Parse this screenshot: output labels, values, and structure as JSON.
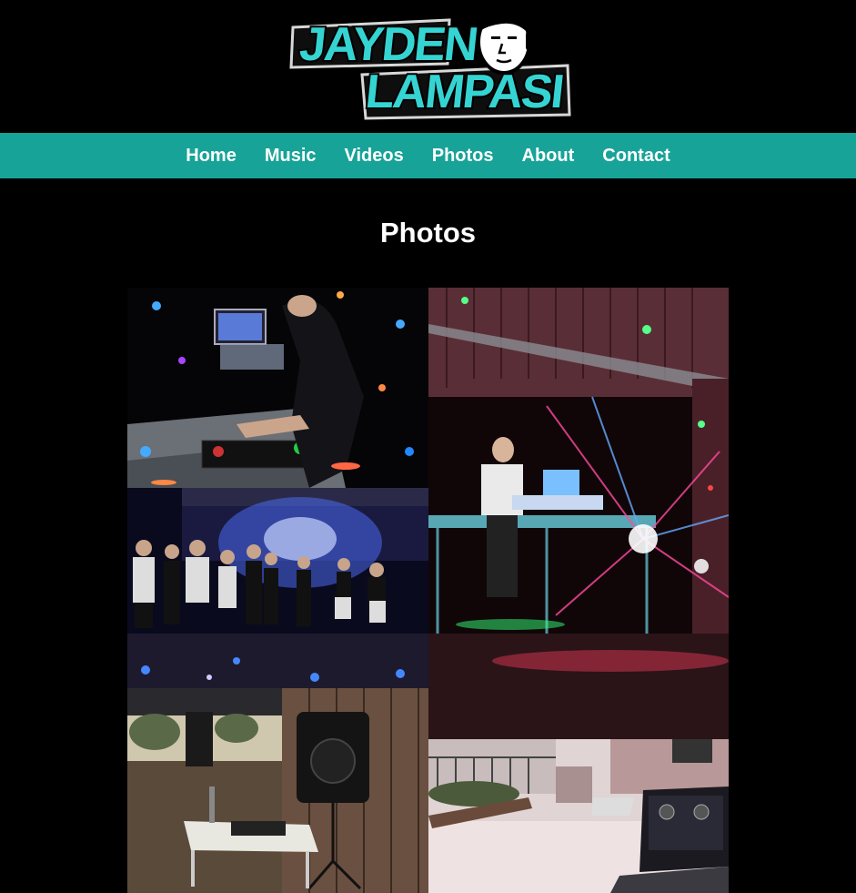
{
  "site": {
    "logo_line1": "JAYDEN",
    "logo_line2": "LAMPASI",
    "brand_color": "#2fd0cf",
    "nav_color": "#17a398"
  },
  "nav": {
    "items": [
      {
        "label": "Home"
      },
      {
        "label": "Music"
      },
      {
        "label": "Videos"
      },
      {
        "label": "Photos"
      },
      {
        "label": "About"
      },
      {
        "label": "Contact"
      }
    ]
  },
  "page": {
    "title": "Photos"
  },
  "gallery": {
    "photos": [
      {
        "id": "dj-at-controller"
      },
      {
        "id": "dj-stage-with-lights"
      },
      {
        "id": "dance-floor-crowd"
      },
      {
        "id": "outdoor-speaker-setup"
      },
      {
        "id": "courtyard-laptop-setup"
      }
    ]
  }
}
